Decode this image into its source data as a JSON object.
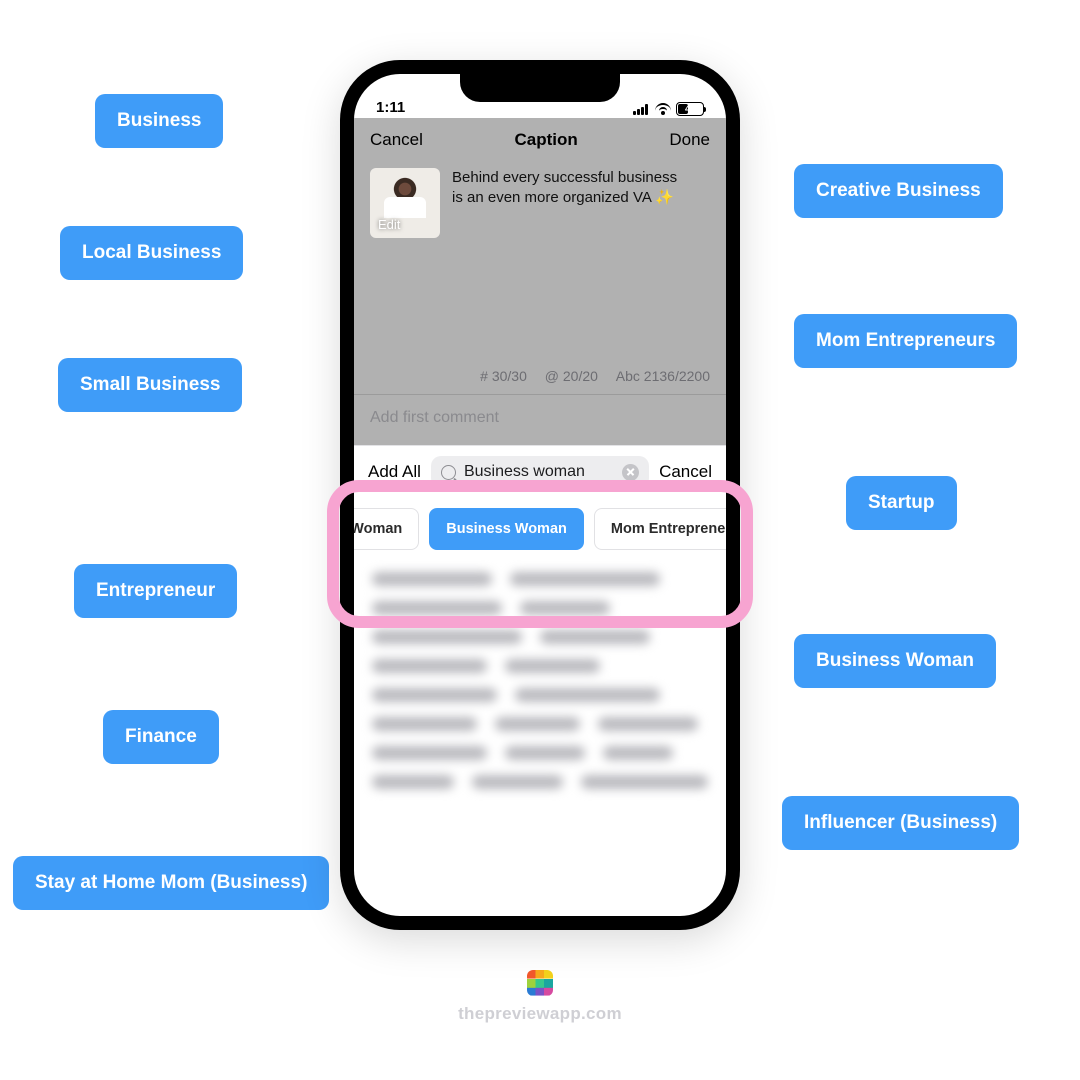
{
  "pills": {
    "left": [
      "Business",
      "Local Business",
      "Small Business",
      "Entrepreneur",
      "Finance",
      "Stay at Home Mom (Business)"
    ],
    "right": [
      "Creative Business",
      "Mom Entrepreneurs",
      "Startup",
      "Business Woman",
      "Influencer (Business)"
    ]
  },
  "statusbar": {
    "time": "1:11",
    "battery": "41"
  },
  "nav": {
    "cancel": "Cancel",
    "title": "Caption",
    "done": "Done"
  },
  "caption": {
    "edit": "Edit",
    "text_line1": "Behind every successful business",
    "text_line2": "is an even more organized VA ",
    "sparkle": "✨"
  },
  "counters": {
    "hash": "# 30/30",
    "at": "@ 20/20",
    "abc": "Abc 2136/2200"
  },
  "first_comment_placeholder": "Add first comment",
  "search": {
    "add_all": "Add All",
    "value": "Business woman",
    "cancel": "Cancel"
  },
  "chips": {
    "left_partial": "siness Woman",
    "selected": "Business Woman",
    "right_partial": "Mom Entreprene"
  },
  "footer": {
    "brand": "thepreviewapp.com"
  }
}
